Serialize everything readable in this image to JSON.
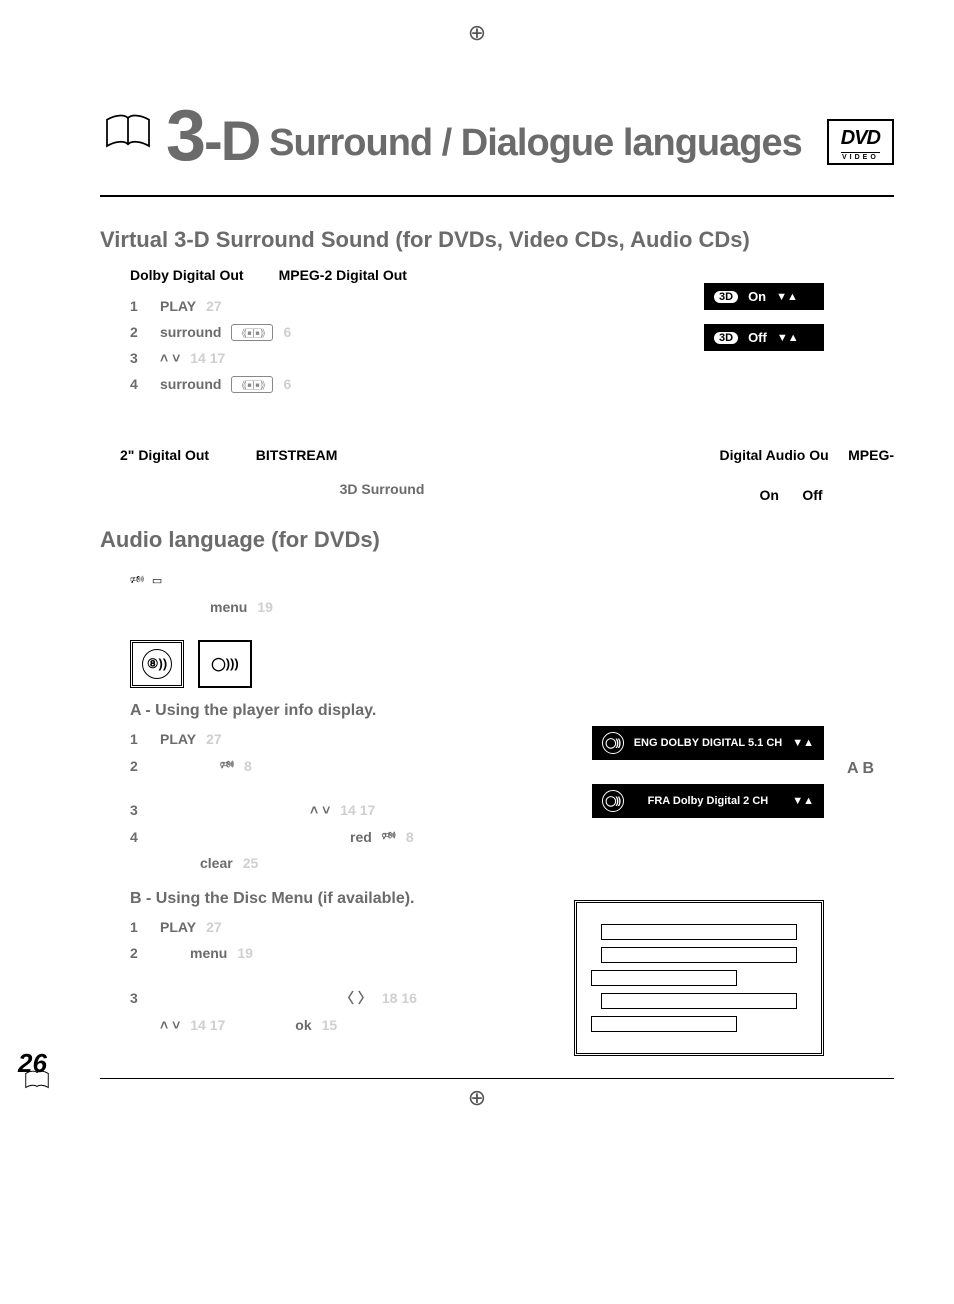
{
  "page_number": "26",
  "header": {
    "title_prefix": "3-D",
    "title_rest": "Surround / Dialogue languages",
    "dvd_label": "DVD",
    "video_label": "VIDEO"
  },
  "section1": {
    "title": "Virtual 3-D Surround Sound  (for DVDs, Video CDs, Audio CDs)",
    "subnote_a": "Dolby Digital Out",
    "subnote_b": "MPEG-2 Digital Out",
    "steps": [
      {
        "num": "1",
        "kw": "PLAY",
        "ghost": "27"
      },
      {
        "num": "2",
        "kw": "surround",
        "extra_ghost": "6",
        "speaker": true
      },
      {
        "num": "3",
        "arrows": "˄ ˅",
        "ghost": "14  17"
      },
      {
        "num": "4",
        "kw": "surround",
        "extra_ghost": "6",
        "speaker": true
      }
    ],
    "osd_on": "On",
    "osd_off": "Off",
    "arrow_glyph": "▼▲"
  },
  "note": {
    "line1_a": "2\" Digital Out",
    "line1_b": "BITSTREAM",
    "line1_right_a": "Digital Audio Ou",
    "line1_right_b": "MPEG-",
    "line2": "3D Surround",
    "line2_on": "On",
    "line2_off": "Off"
  },
  "section2": {
    "title": "Audio language (for DVDs)",
    "menu_kw": "menu",
    "menu_ghost": "19",
    "ab_label": "A   B",
    "methodA": {
      "title": "A - Using the player info display.",
      "steps": [
        {
          "num": "1",
          "kw": "PLAY",
          "ghost": "27"
        },
        {
          "num": "2",
          "sound_icon": true,
          "ghost": "8"
        },
        {
          "num": "3",
          "arrows": "˄ ˅",
          "ghost": "14  17"
        },
        {
          "num": "4",
          "kw": "red",
          "sound_icon": true,
          "ghost": "8",
          "kw2": "clear",
          "ghost2": "25"
        }
      ],
      "osd1": "ENG DOLBY DIGITAL 5.1 CH",
      "osd2": "FRA Dolby Digital 2 CH",
      "arrow_glyph": "▼▲"
    },
    "methodB": {
      "title": "B - Using the Disc Menu (if available).",
      "steps": [
        {
          "num": "1",
          "kw": "PLAY",
          "ghost": "27"
        },
        {
          "num": "2",
          "kw": "menu",
          "ghost": "19"
        },
        {
          "num": "3",
          "arrows_lr": "〈 〉",
          "ghost_lr": "18  16",
          "arrows_ud": "˄ ˅",
          "ghost_ud": "14  17",
          "kw": "ok",
          "ghost_ok": "15"
        }
      ]
    }
  }
}
